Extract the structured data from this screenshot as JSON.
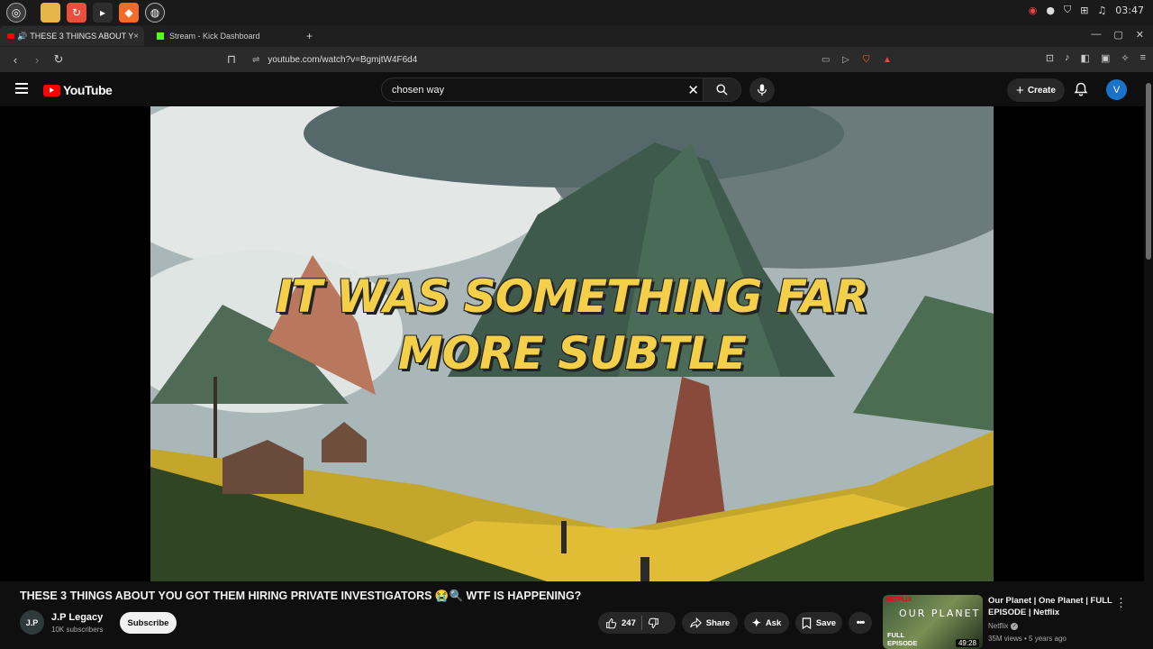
{
  "taskbar": {
    "clock": "03:47"
  },
  "tabs": [
    {
      "label": "THESE 3 THINGS ABOUT Y",
      "close": "×"
    },
    {
      "label": "Stream - Kick Dashboard"
    }
  ],
  "tab_add": "+",
  "window": {
    "minimize": "—",
    "maximize": "▢",
    "close": "✕"
  },
  "nav": {
    "url": "youtube.com/watch?v=BgmjtW4F6d4"
  },
  "header": {
    "logo_text": "YouTube",
    "search_value": "chosen way",
    "create_label": "Create",
    "avatar_letter": "V"
  },
  "video": {
    "caption_line1": "IT WAS SOMETHING FAR",
    "caption_line2": "MORE SUBTLE"
  },
  "info": {
    "title": "THESE 3 THINGS ABOUT YOU GOT THEM HIRING PRIVATE INVESTIGATORS 😭🔍 WTF IS HAPPENING?",
    "channel_avatar": "J.P",
    "channel_name": "J.P Legacy",
    "subscribers": "10K subscribers",
    "subscribe_label": "Subscribe",
    "likes": "247",
    "share_label": "Share",
    "ask_label": "Ask",
    "save_label": "Save"
  },
  "recommendation": {
    "thumb_brand": "NETFLIX",
    "thumb_title": "OUR PLANET",
    "thumb_tag": "FULL EPISODE",
    "duration": "49:28",
    "title": "Our Planet | One Planet | FULL EPISODE | Netflix",
    "channel": "Netflix",
    "meta": "35M views • 5 years ago"
  },
  "colors": {
    "yt_red": "#ff0000",
    "caption_yellow": "#f4d04a",
    "avatar_blue": "#1a73c9"
  }
}
